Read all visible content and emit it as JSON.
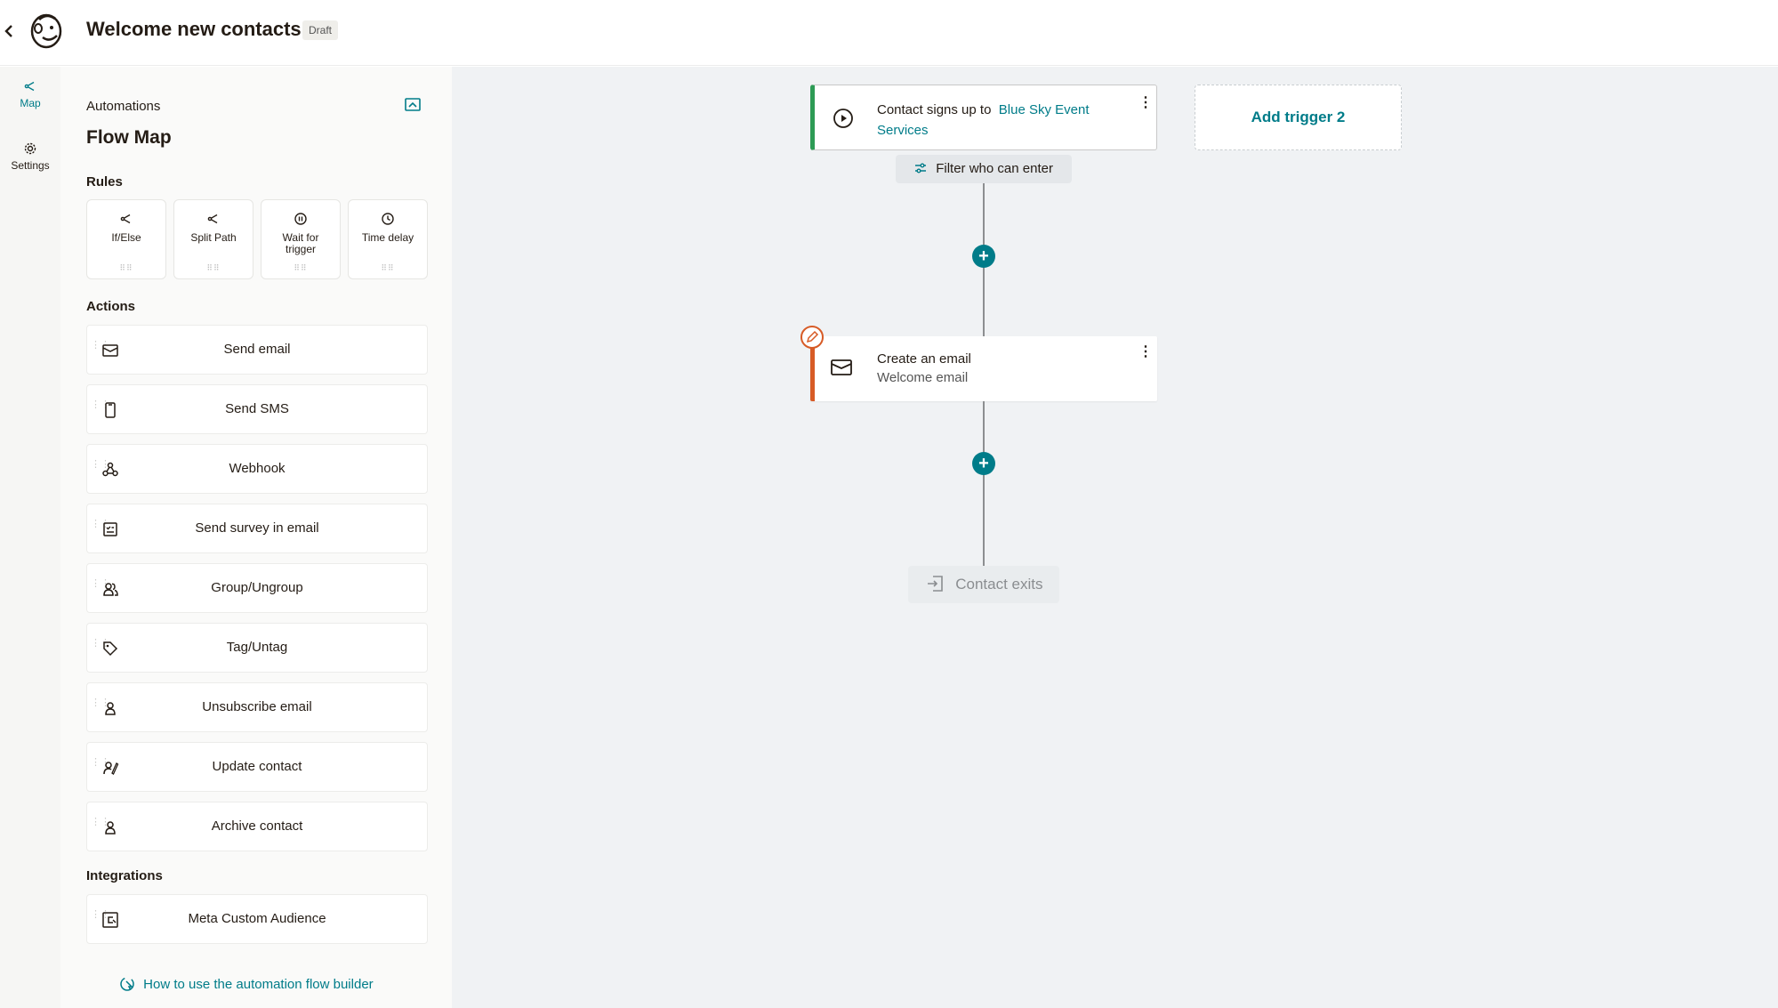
{
  "header": {
    "back_icon": "chevron-left-icon",
    "logo": "mailchimp-freddie-logo",
    "title": "Welcome new contacts",
    "badge": "Draft"
  },
  "rail": {
    "items": [
      {
        "label": "Map",
        "icon": "flow-map-icon",
        "active": true
      },
      {
        "label": "Settings",
        "icon": "gear-icon",
        "active": false
      }
    ]
  },
  "sidebar": {
    "subtitle": "Automations",
    "title": "Flow Map",
    "toggle_icon": "collapse-panel-icon",
    "rules_heading": "Rules",
    "rules": [
      {
        "label": "If/Else",
        "icon": "branch-icon"
      },
      {
        "label": "Split Path",
        "icon": "split-icon"
      },
      {
        "label": "Wait for trigger",
        "icon": "pause-icon"
      },
      {
        "label": "Time delay",
        "icon": "clock-icon"
      }
    ],
    "actions_heading": "Actions",
    "actions": [
      {
        "label": "Send email",
        "icon": "envelope-icon"
      },
      {
        "label": "Send SMS",
        "icon": "phone-icon"
      },
      {
        "label": "Webhook",
        "icon": "webhook-icon"
      },
      {
        "label": "Send survey in email",
        "icon": "survey-icon"
      },
      {
        "label": "Group/Ungroup",
        "icon": "group-icon"
      },
      {
        "label": "Tag/Untag",
        "icon": "tag-icon"
      },
      {
        "label": "Unsubscribe email",
        "icon": "person-icon"
      },
      {
        "label": "Update contact",
        "icon": "person-edit-icon"
      },
      {
        "label": "Archive contact",
        "icon": "person-icon"
      }
    ],
    "integrations_heading": "Integrations",
    "integrations": [
      {
        "label": "Meta Custom Audience",
        "icon": "meta-audience-icon"
      }
    ],
    "help_link": "How to use the automation flow builder",
    "help_icon": "help-cursor-icon"
  },
  "canvas": {
    "trigger": {
      "text": "Contact signs up to",
      "link": "Blue Sky Event Services",
      "icon": "play-circle-icon",
      "accent": "#2d9b55"
    },
    "add_trigger": "Add trigger 2",
    "filter": "Filter who can enter",
    "email_step": {
      "title": "Create an email",
      "subtitle": "Welcome email",
      "icon": "envelope-icon",
      "accent": "#d75b26"
    },
    "exit": "Contact exits",
    "brand_color": "#007c89"
  }
}
